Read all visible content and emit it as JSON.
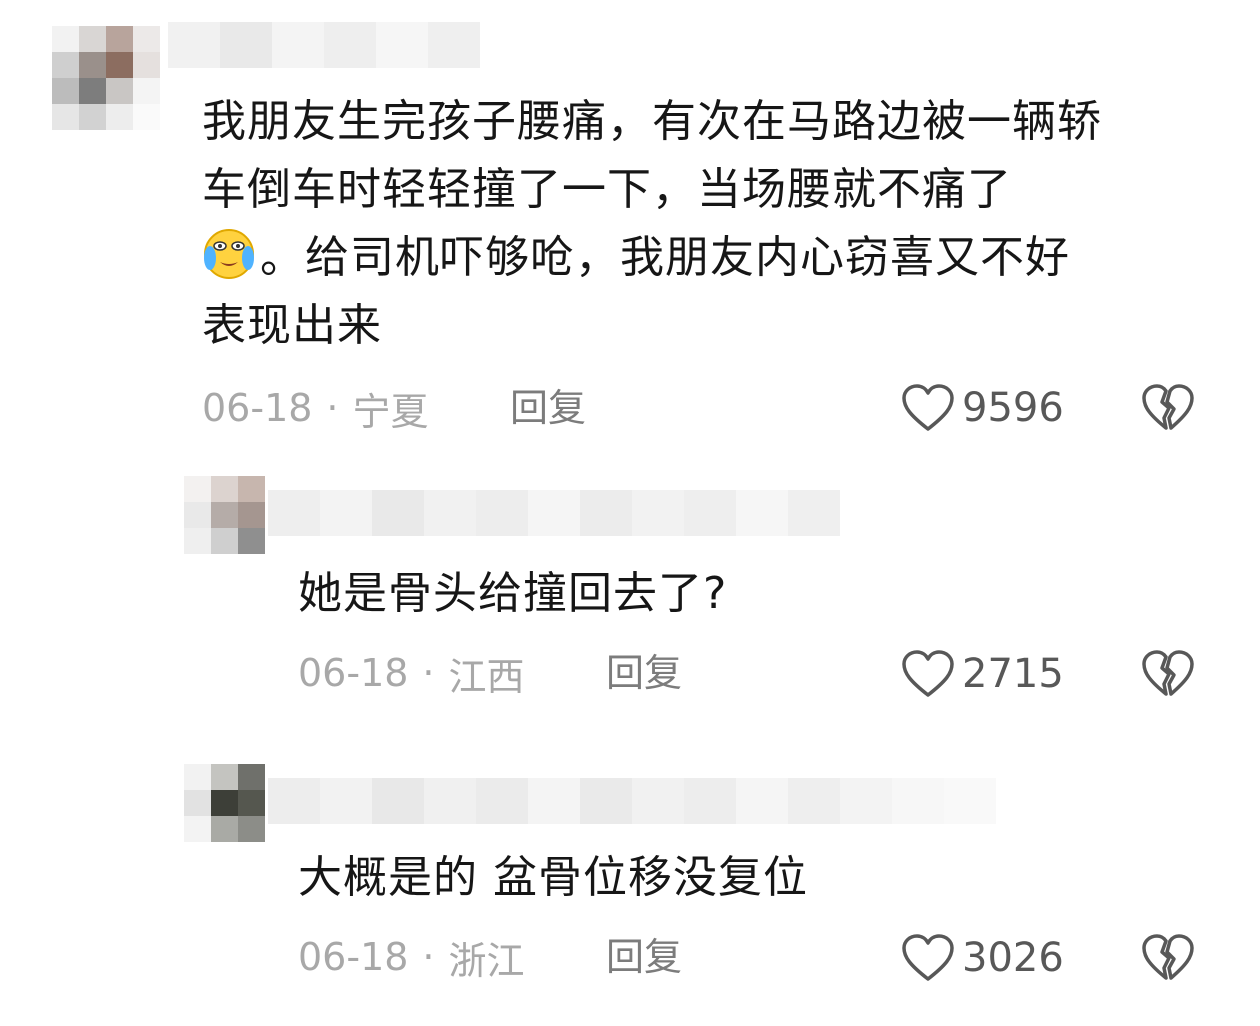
{
  "comments": [
    {
      "text_line1": "我朋友生完孩子腰痛，有次在马路边被一辆轿",
      "text_line2": "车倒车时轻轻撞了一下，当场腰就不痛了",
      "text_line3": "。给司机吓够呛，我朋友内心窃喜又不好",
      "text_line4": "表现出来",
      "emoji": "crying-laughing-emoji",
      "date": "06-18",
      "location": "宁夏",
      "reply_label": "回复",
      "likes": "9596"
    },
    {
      "text": "她是骨头给撞回去了?",
      "date": "06-18",
      "location": "江西",
      "reply_label": "回复",
      "likes": "2715"
    },
    {
      "text": "大概是的 盆骨位移没复位",
      "date": "06-18",
      "location": "浙江",
      "reply_label": "回复",
      "likes": "3026"
    }
  ],
  "separator": "·",
  "icons": {
    "like": "heart-outline-icon",
    "dislike": "broken-heart-icon"
  },
  "colors": {
    "text": "#161616",
    "meta": "#a8a8a8",
    "reply": "#7c7c7c",
    "count": "#585858"
  }
}
